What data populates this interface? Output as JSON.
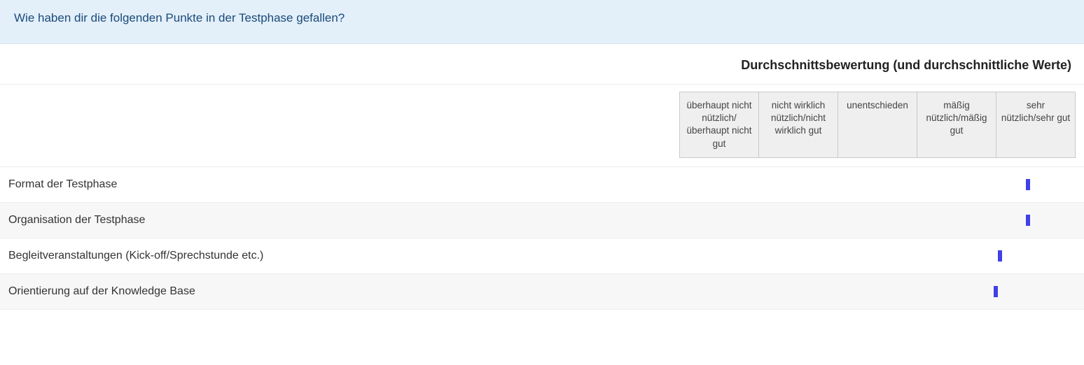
{
  "question": "Wie haben dir die folgenden Punkte in der Testphase gefallen?",
  "subtitle": "Durchschnittsbewertung (und durchschnittliche Werte)",
  "scale": [
    "überhaupt nicht nützlich/ überhaupt nicht gut",
    "nicht wirklich nützlich/nicht wirklich gut",
    "unentschieden",
    "mäßig nützlich/mäßig gut",
    "sehr nützlich/sehr gut"
  ],
  "rows": [
    {
      "label": "Format der Testphase",
      "value": 4.9
    },
    {
      "label": "Organisation der Testphase",
      "value": 4.9
    },
    {
      "label": "Begleitveranstaltungen (Kick-off/Sprechstunde etc.)",
      "value": 4.55
    },
    {
      "label": "Orientierung auf der Knowledge Base",
      "value": 4.5
    }
  ],
  "chart_data": {
    "type": "bar",
    "title": "Wie haben dir die folgenden Punkte in der Testphase gefallen?",
    "subtitle": "Durchschnittsbewertung (und durchschnittliche Werte)",
    "xlabel": "",
    "ylabel": "",
    "categories": [
      "Format der Testphase",
      "Organisation der Testphase",
      "Begleitveranstaltungen (Kick-off/Sprechstunde etc.)",
      "Orientierung auf der Knowledge Base"
    ],
    "values": [
      4.9,
      4.9,
      4.55,
      4.5
    ],
    "scale_labels": [
      "überhaupt nicht nützlich/ überhaupt nicht gut",
      "nicht wirklich nützlich/nicht wirklich gut",
      "unentschieden",
      "mäßig nützlich/mäßig gut",
      "sehr nützlich/sehr gut"
    ],
    "xlim": [
      1,
      5
    ]
  }
}
